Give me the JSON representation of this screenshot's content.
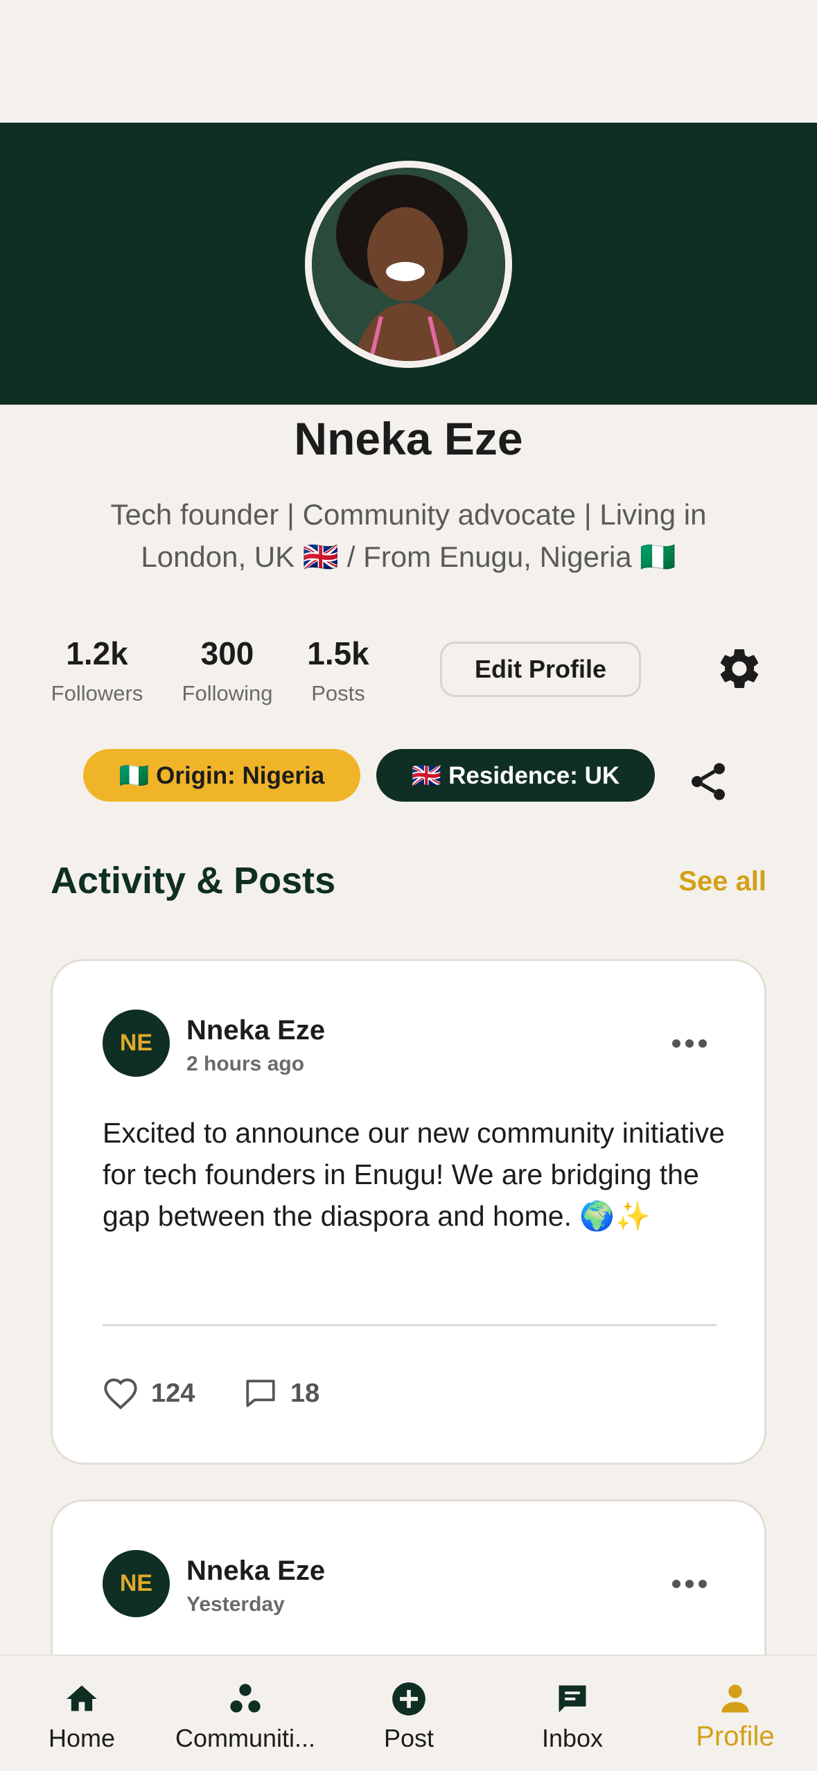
{
  "profile": {
    "name": "Nneka Eze",
    "bio": "Tech founder | Community advocate | Living in London, UK 🇬🇧 / From Enugu, Nigeria 🇳🇬"
  },
  "stats": [
    {
      "value": "1.2k",
      "label": "Followers"
    },
    {
      "value": "300",
      "label": "Following"
    },
    {
      "value": "1.5k",
      "label": "Posts"
    }
  ],
  "actions": {
    "edit_profile": "Edit Profile",
    "settings_icon": "gear-icon",
    "share_icon": "share-icon"
  },
  "chips": {
    "origin": "🇳🇬 Origin: Nigeria",
    "residence": "🇬🇧 Residence: UK"
  },
  "section": {
    "title": "Activity & Posts",
    "see_all": "See all"
  },
  "posts": [
    {
      "initials": "NE",
      "author": "Nneka Eze",
      "time": "2 hours ago",
      "text": "Excited to announce our new community initiative for tech founders in Enugu! We are bridging the gap between the diaspora and home. 🌍✨",
      "likes": "124",
      "comments": "18"
    },
    {
      "initials": "NE",
      "author": "Nneka Eze",
      "time": "Yesterday"
    }
  ],
  "tabs": [
    {
      "label": "Home",
      "icon": "home-icon"
    },
    {
      "label": "Communiti...",
      "icon": "communities-icon"
    },
    {
      "label": "Post",
      "icon": "plus-circle-icon"
    },
    {
      "label": "Inbox",
      "icon": "chat-icon"
    },
    {
      "label": "Profile",
      "icon": "person-icon",
      "active": true
    }
  ],
  "colors": {
    "primary": "#0f2e24",
    "accent": "#d4a017",
    "chip_yellow": "#f0b429",
    "background": "#f4f1ec"
  }
}
